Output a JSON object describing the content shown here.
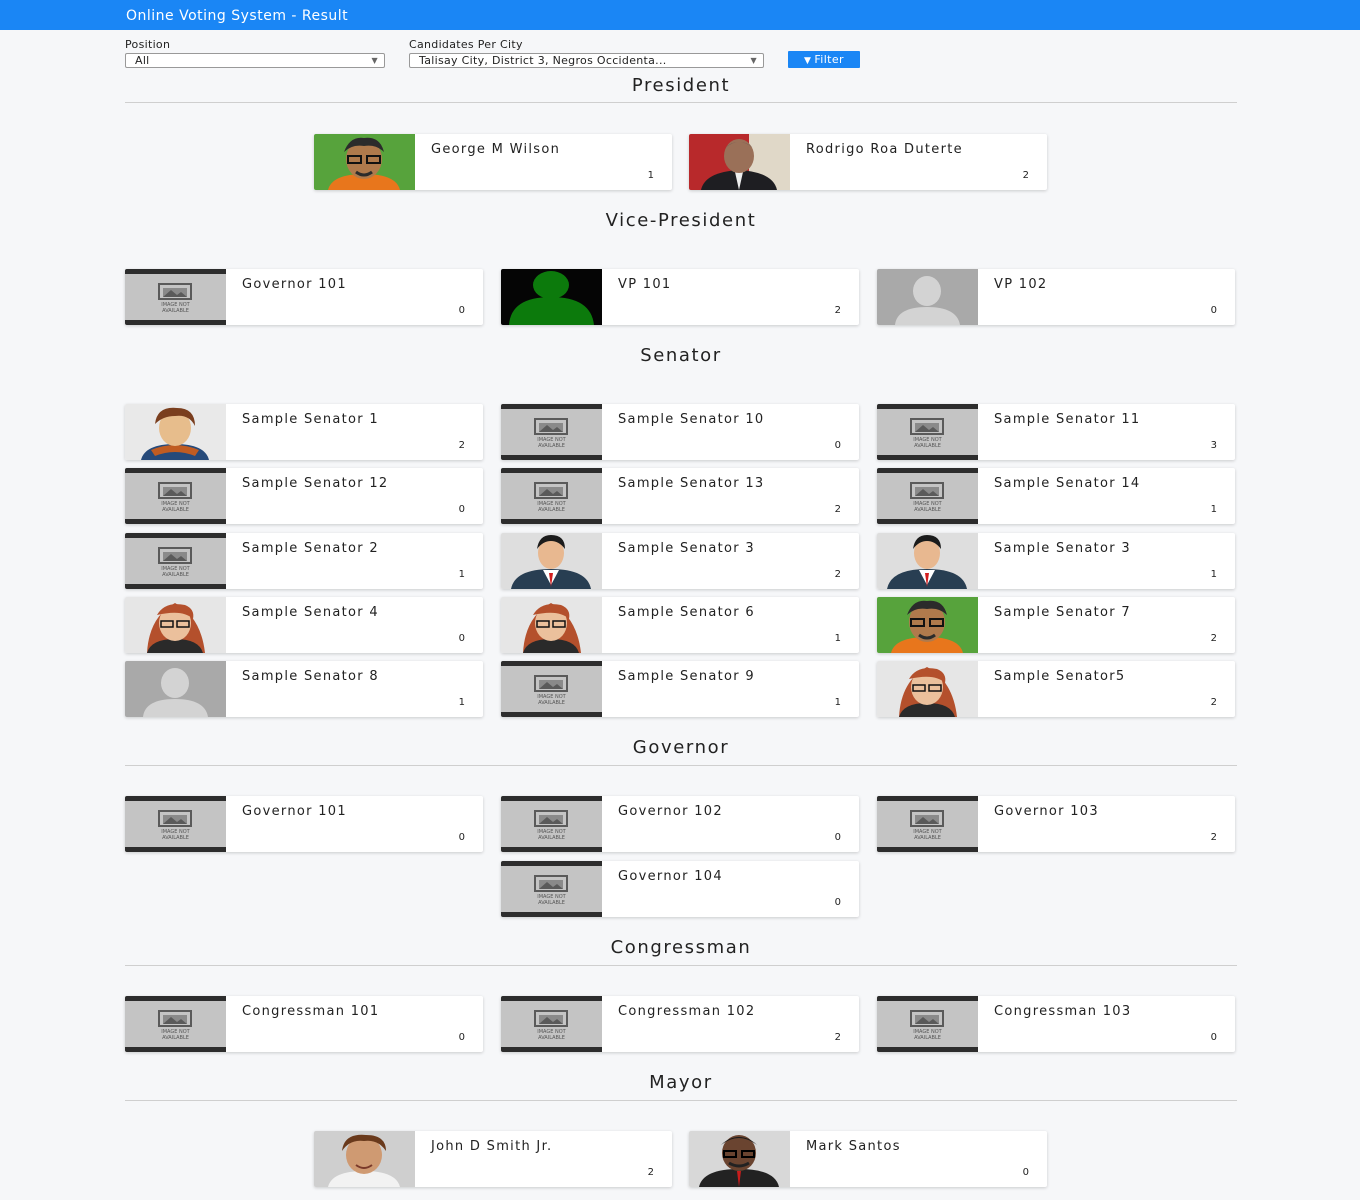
{
  "app": {
    "title": "Online Voting System - Result"
  },
  "filters": {
    "position_label": "Position",
    "position_value": "All",
    "city_label": "Candidates Per City",
    "city_value": "Talisay City, District 3, Negros Occidenta...",
    "filter_button": "Filter"
  },
  "sections": [
    {
      "title": "President",
      "candidates": [
        {
          "name": "George M Wilson",
          "votes": "1",
          "photo": "cartoon-man-glasses-green"
        },
        {
          "name": "Rodrigo Roa Duterte",
          "votes": "2",
          "photo": "photo-man-suit-red"
        }
      ]
    },
    {
      "title": "Vice-President",
      "candidates": [
        {
          "name": "Governor 101",
          "votes": "0",
          "photo": "image-not-available"
        },
        {
          "name": "VP 101",
          "votes": "2",
          "photo": "green-silhouette"
        },
        {
          "name": "VP 102",
          "votes": "0",
          "photo": "gray-silhouette"
        }
      ]
    },
    {
      "title": "Senator",
      "candidates": [
        {
          "name": "Sample Senator 1",
          "votes": "2",
          "photo": "cartoon-man-scarf"
        },
        {
          "name": "Sample Senator 10",
          "votes": "0",
          "photo": "image-not-available"
        },
        {
          "name": "Sample Senator 11",
          "votes": "3",
          "photo": "image-not-available"
        },
        {
          "name": "Sample Senator 12",
          "votes": "0",
          "photo": "image-not-available"
        },
        {
          "name": "Sample Senator 13",
          "votes": "2",
          "photo": "image-not-available"
        },
        {
          "name": "Sample Senator 14",
          "votes": "1",
          "photo": "image-not-available"
        },
        {
          "name": "Sample Senator 2",
          "votes": "1",
          "photo": "image-not-available"
        },
        {
          "name": "Sample Senator 3",
          "votes": "2",
          "photo": "cartoon-man-suit"
        },
        {
          "name": "Sample Senator 3",
          "votes": "1",
          "photo": "cartoon-man-suit"
        },
        {
          "name": "Sample Senator 4",
          "votes": "0",
          "photo": "cartoon-woman-redhair"
        },
        {
          "name": "Sample Senator 6",
          "votes": "1",
          "photo": "cartoon-woman-redhair"
        },
        {
          "name": "Sample Senator 7",
          "votes": "2",
          "photo": "cartoon-man-glasses-green"
        },
        {
          "name": "Sample Senator 8",
          "votes": "1",
          "photo": "gray-silhouette"
        },
        {
          "name": "Sample Senator 9",
          "votes": "1",
          "photo": "image-not-available"
        },
        {
          "name": "Sample Senator5",
          "votes": "2",
          "photo": "cartoon-woman-redhair"
        }
      ]
    },
    {
      "title": "Governor",
      "candidates": [
        {
          "name": "Governor 101",
          "votes": "0",
          "photo": "image-not-available"
        },
        {
          "name": "Governor 102",
          "votes": "0",
          "photo": "image-not-available"
        },
        {
          "name": "Governor 103",
          "votes": "2",
          "photo": "image-not-available"
        },
        {
          "name": "Governor 104",
          "votes": "0",
          "photo": "image-not-available"
        }
      ]
    },
    {
      "title": "Congressman",
      "candidates": [
        {
          "name": "Congressman 101",
          "votes": "0",
          "photo": "image-not-available"
        },
        {
          "name": "Congressman 102",
          "votes": "2",
          "photo": "image-not-available"
        },
        {
          "name": "Congressman 103",
          "votes": "0",
          "photo": "image-not-available"
        }
      ]
    },
    {
      "title": "Mayor",
      "candidates": [
        {
          "name": "John D Smith Jr.",
          "votes": "2",
          "photo": "cartoon-man-brown-hair"
        },
        {
          "name": "Mark Santos",
          "votes": "0",
          "photo": "cartoon-man-dark-glasses"
        }
      ]
    }
  ],
  "placeholder_text": [
    "IMAGE NOT",
    "AVAILABLE"
  ],
  "colors": {
    "accent": "#1a86f5",
    "background": "#f6f7f9"
  }
}
